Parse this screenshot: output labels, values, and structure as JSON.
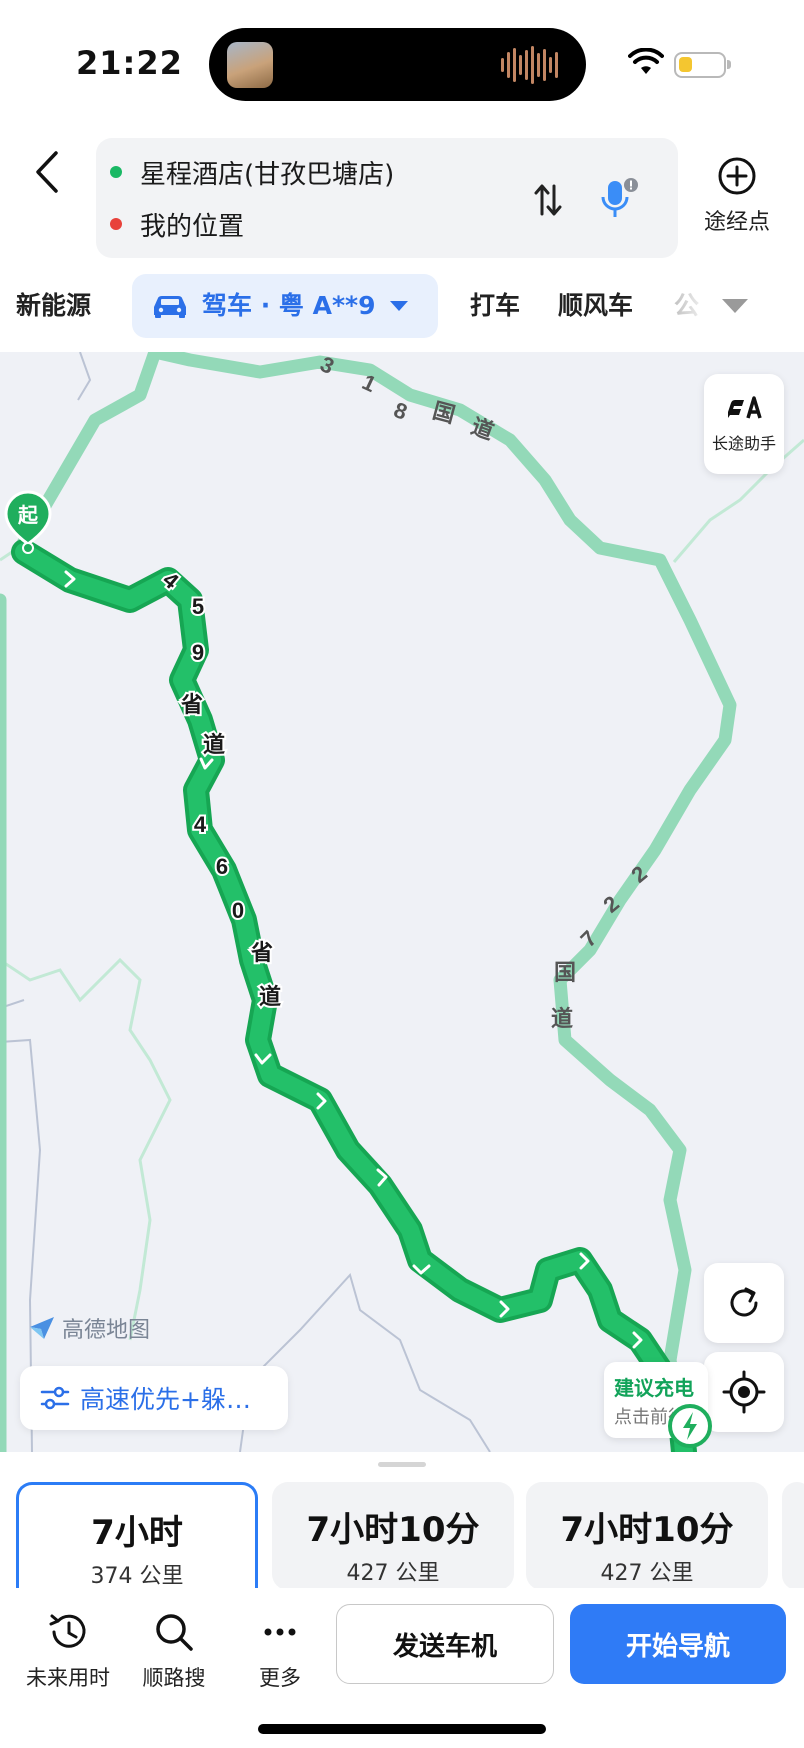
{
  "status_bar": {
    "time": "21:22",
    "battery_level": 0.3
  },
  "header": {
    "from": "星程酒店(甘孜巴塘店)",
    "to": "我的位置",
    "from_dot_color": "#1ab864",
    "to_dot_color": "#e8413a",
    "waypoint_label": "途经点"
  },
  "mode_tabs": {
    "new_energy": "新能源",
    "drive": "驾车 · 粤 A**9",
    "taxi": "打车",
    "carpool": "顺风车",
    "truncated": "公"
  },
  "map": {
    "longtrip_label": "长途助手",
    "start_marker_label": "起",
    "logo_text": "高德地图",
    "preference": "高速优先+躲…",
    "charge_title": "建议充电",
    "charge_sub": "点击前往",
    "road_labels": {
      "national_318": [
        "3",
        "1",
        "8",
        "国",
        "道"
      ],
      "provincial_459": [
        "4",
        "5",
        "9",
        "省",
        "道"
      ],
      "provincial_460": [
        "4",
        "6",
        "0",
        "省",
        "道"
      ],
      "national_227": [
        "2",
        "2",
        "7",
        "国",
        "道"
      ]
    }
  },
  "route_options": [
    {
      "time": "7小时",
      "distance": "374 公里",
      "selected": true
    },
    {
      "time": "7小时10分",
      "distance": "427 公里",
      "selected": false
    },
    {
      "time": "7小时10分",
      "distance": "427 公里",
      "selected": false
    }
  ],
  "actions": {
    "future_time": "未来用时",
    "search_along": "顺路搜",
    "more": "更多",
    "send_to_car": "发送车机",
    "start_navigation": "开始导航"
  },
  "colors": {
    "accent": "#2b7cf6",
    "route_green": "#1db35f",
    "alt_route": "#93d9b8"
  },
  "icons": [
    "back-arrow-icon",
    "swap-icon",
    "microphone-icon",
    "plus-circle-icon",
    "car-icon",
    "chevron-down-icon",
    "longtrip-icon",
    "refresh-icon",
    "locate-icon",
    "filter-icon",
    "clock-icon",
    "search-icon",
    "more-dots-icon",
    "charging-icon",
    "wifi-icon",
    "battery-icon"
  ]
}
